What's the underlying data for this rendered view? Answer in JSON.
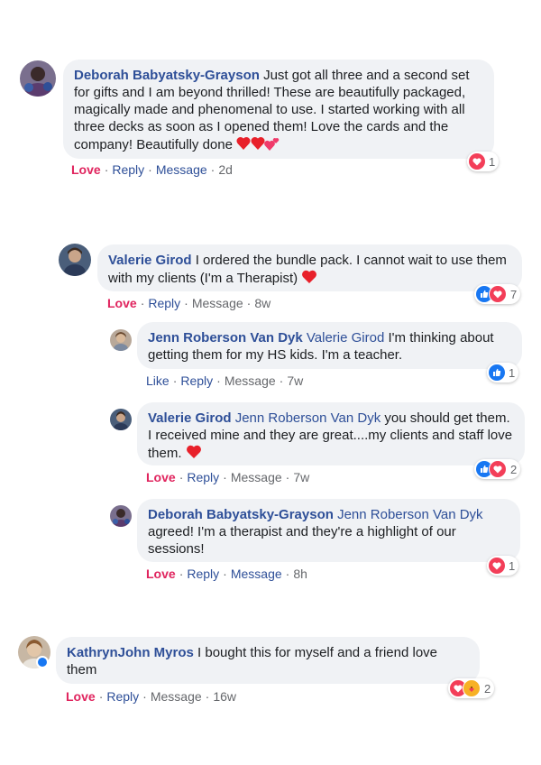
{
  "colors": {
    "author": "#2e4f98",
    "love": "#e0245e",
    "bubble": "#f0f2f5",
    "heart": "#f33e58",
    "like": "#1877f2"
  },
  "comments": [
    {
      "author": "Deborah Babyatsky-Grayson",
      "mention": "",
      "text": "Just got all three and a second set for gifts and I am beyond thrilled! These are beautifully packaged, magically made and phenomenal to use. I started working with all three decks as soon as I opened them! Love the cards and the company! Beautifully done",
      "actions": {
        "reaction": "Love",
        "reply": "Reply",
        "message": "Message",
        "time": "2d"
      },
      "reaction_count": "1",
      "reaction_icons": [
        "heart-icon"
      ]
    },
    {
      "author": "Valerie Girod",
      "mention": "",
      "text": "I ordered the bundle pack. I cannot wait to use them with my clients (I'm a Therapist)",
      "actions": {
        "reaction": "Love",
        "reply": "Reply",
        "message": "Message",
        "time": "8w"
      },
      "reaction_count": "7",
      "reaction_icons": [
        "like-icon",
        "heart-icon"
      ]
    },
    {
      "author": "Jenn Roberson Van Dyk",
      "mention": "Valerie Girod",
      "text": "I'm thinking about getting them for my HS kids. I'm a teacher.",
      "actions": {
        "reaction": "Like",
        "reply": "Reply",
        "message": "Message",
        "time": "7w"
      },
      "reaction_count": "1",
      "reaction_icons": [
        "like-icon"
      ]
    },
    {
      "author": "Valerie Girod",
      "mention": "Jenn Roberson Van Dyk",
      "text": "you should get them. I received mine and they are great....my clients and staff love them.",
      "actions": {
        "reaction": "Love",
        "reply": "Reply",
        "message": "Message",
        "time": "7w"
      },
      "reaction_count": "2",
      "reaction_icons": [
        "like-icon",
        "heart-icon"
      ]
    },
    {
      "author": "Deborah Babyatsky-Grayson",
      "mention": "Jenn Roberson Van Dyk",
      "text": "agreed! I'm a therapist and they're a highlight of our sessions!",
      "actions": {
        "reaction": "Love",
        "reply": "Reply",
        "message": "Message",
        "time": "8h"
      },
      "reaction_count": "1",
      "reaction_icons": [
        "heart-icon"
      ]
    },
    {
      "author": "KathrynJohn Myros",
      "mention": "",
      "text": "I bought this for myself and a friend love them",
      "actions": {
        "reaction": "Love",
        "reply": "Reply",
        "message": "Message",
        "time": "16w"
      },
      "reaction_count": "2",
      "reaction_icons": [
        "heart-icon",
        "care-icon"
      ]
    }
  ]
}
